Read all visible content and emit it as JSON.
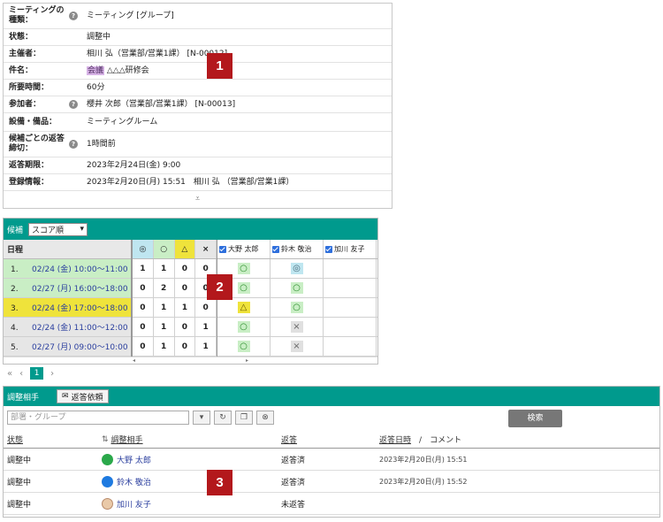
{
  "info": {
    "rows": [
      {
        "label": "ミーティングの種類：",
        "value": "ミーティング [グループ]",
        "help": true
      },
      {
        "label": "状態：",
        "value": "調整中"
      },
      {
        "label": "主催者：",
        "value": "相川 弘（営業部/営業1課） [N-00012]"
      },
      {
        "label": "件名：",
        "value_tag": "会議",
        "value": " △△△研修会"
      },
      {
        "label": "所要時間：",
        "value": "60分"
      },
      {
        "label": "参加者：",
        "value": "櫻井 次郎（営業部/営業1課） [N-00013]",
        "help": true
      },
      {
        "label": "設備・備品：",
        "value": "ミーティングルーム"
      },
      {
        "label": "候補ごとの返答締切：",
        "value": "1時間前",
        "help": true
      },
      {
        "label": "返答期限：",
        "value": "2023年2月24日(金) 9:00"
      },
      {
        "label": "登録情報：",
        "value": "2023年2月20日(月) 15:51　相川 弘 （営業部/営業1課）"
      }
    ],
    "expand_glyph": "⩡"
  },
  "markers": [
    "1",
    "2",
    "3"
  ],
  "candidates": {
    "label": "候補",
    "sort_value": "スコア順",
    "date_header": "日程",
    "score_headers": [
      "◎",
      "○",
      "△",
      "×"
    ],
    "people": [
      "大野 太郎",
      "鈴木 敬治",
      "加川 友子"
    ],
    "rows": [
      {
        "n": "1.",
        "date": "02/24 (金) 10:00～11:00",
        "scores": [
          "1",
          "1",
          "0",
          "0"
        ],
        "marks": [
          "○",
          "◎",
          ""
        ],
        "color": "#c9eec5"
      },
      {
        "n": "2.",
        "date": "02/27 (月) 16:00～18:00",
        "scores": [
          "0",
          "2",
          "0",
          "0"
        ],
        "marks": [
          "○",
          "○",
          ""
        ],
        "color": "#c9eec5"
      },
      {
        "n": "3.",
        "date": "02/24 (金) 17:00～18:00",
        "scores": [
          "0",
          "1",
          "1",
          "0"
        ],
        "marks": [
          "△",
          "○",
          ""
        ],
        "color": "#efe33b"
      },
      {
        "n": "4.",
        "date": "02/24 (金) 11:00～12:00",
        "scores": [
          "0",
          "1",
          "0",
          "1"
        ],
        "marks": [
          "○",
          "×",
          ""
        ],
        "color": "#e6e6e6"
      },
      {
        "n": "5.",
        "date": "02/27 (月) 09:00～10:00",
        "scores": [
          "0",
          "1",
          "0",
          "1"
        ],
        "marks": [
          "○",
          "×",
          ""
        ],
        "color": "#e6e6e6"
      }
    ]
  },
  "pager": {
    "first": "«",
    "prev": "‹",
    "current": "1",
    "next": "›"
  },
  "participants": {
    "label": "調整相手",
    "reply_button": "返答依頼",
    "group_placeholder": "部署・グループ",
    "search_button": "検索",
    "headers": {
      "status": "状態",
      "name": "調整相手",
      "reply": "返答",
      "date": "返答日時",
      "slash": "/",
      "comment": "コメント"
    },
    "rows": [
      {
        "status": "調整中",
        "name": "大野 太郎",
        "reply": "返答済",
        "date": "2023年2月20日(月) 15:51",
        "avatar": "green"
      },
      {
        "status": "調整中",
        "name": "鈴木 敬治",
        "reply": "返答済",
        "date": "2023年2月20日(月) 15:52",
        "avatar": "blue"
      },
      {
        "status": "調整中",
        "name": "加川 友子",
        "reply": "未返答",
        "date": "",
        "avatar": "photo"
      }
    ]
  }
}
